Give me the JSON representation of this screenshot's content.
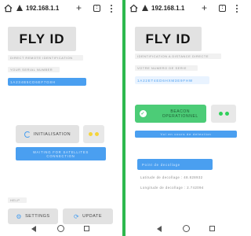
{
  "browser": {
    "url": "192.168.1.1",
    "tab_count": ":"
  },
  "left": {
    "logo": "FLY ID",
    "subtitle": "DIRECT REMOTE IDENTIFICATION",
    "serial_label": "YOUR SERIAL NUMBER",
    "serial_value": "1A234B5CD6EF7G8H",
    "init_label": "INITIALISATION",
    "waiting_text": "WAITING FOR SATELLITES CONNECTION",
    "help_label": "HELP",
    "settings_label": "SETTINGS",
    "update_label": "UPDATE"
  },
  "right": {
    "logo": "FLY ID",
    "subtitle": "IDENTIFICATION A DISTANCE DIRECTE",
    "serial_label": "VOTRE NUMERO DE SERIE",
    "serial_value": "1A22ET4ED6HXM3E9FHW",
    "beacon_label": "BEACON OPERATIONNEL",
    "status_bar": "Vol en cours de detection",
    "takeoff_bar": "Point de decollage",
    "lat_text": "Latitude de decollage : 48.828932",
    "lon_text": "Longitude de decollage : 2.742094"
  },
  "colors": {
    "divider": "#2db84d",
    "accent_blue": "#4a9ff0",
    "beacon_green": "#4ccc77",
    "status_yellow": "#f5d43a",
    "status_green": "#2fd05a"
  }
}
